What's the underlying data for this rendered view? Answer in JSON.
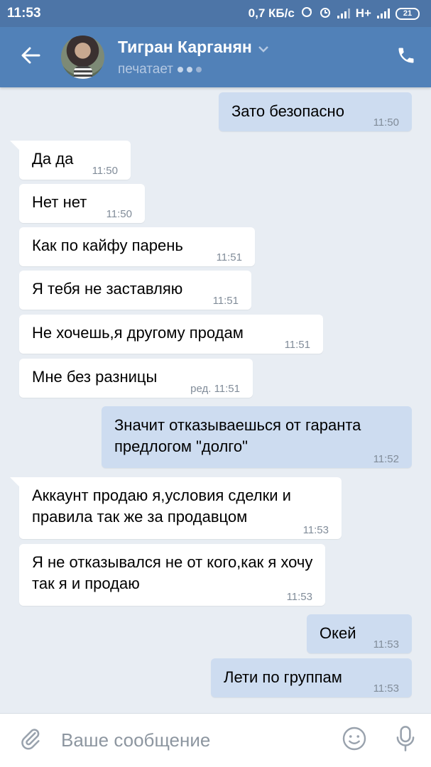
{
  "status_bar": {
    "time": "11:53",
    "net_speed": "0,7 КБ/с",
    "network_type": "H+",
    "battery": "21",
    "icons": [
      "sync-icon",
      "alarm-icon",
      "signal-icon",
      "signal-icon",
      "battery-icon"
    ]
  },
  "header": {
    "contact_name": "Тигран Карганян",
    "status": "печатает",
    "icons": [
      "back-arrow-icon",
      "chevron-down-icon",
      "phone-icon"
    ]
  },
  "messages": [
    {
      "direction": "out",
      "text": "Зато безопасно",
      "time": "11:50"
    },
    {
      "direction": "in",
      "text": "Да да",
      "time": "11:50"
    },
    {
      "direction": "in",
      "text": "Нет нет",
      "time": "11:50"
    },
    {
      "direction": "in",
      "text": "Как по кайфу парень",
      "time": "11:51"
    },
    {
      "direction": "in",
      "text": "Я тебя не заставляю",
      "time": "11:51"
    },
    {
      "direction": "in",
      "text": "Не хочешь,я другому продам",
      "time": "11:51"
    },
    {
      "direction": "in",
      "text": "Мне без разницы",
      "time": "ред. 11:51"
    },
    {
      "direction": "out",
      "text": "Значит отказываешься от гаранта предлогом \"долго\"",
      "time": "11:52"
    },
    {
      "direction": "in",
      "text": "Аккаунт продаю я,условия сделки и правила так же за продавцом",
      "time": "11:53"
    },
    {
      "direction": "in",
      "text": "Я не отказывался не от кого,как я хочу так я и продаю",
      "time": "11:53"
    },
    {
      "direction": "out",
      "text": "Окей",
      "time": "11:53"
    },
    {
      "direction": "out",
      "text": "Лети по группам",
      "time": "11:53"
    }
  ],
  "composer": {
    "placeholder": "Ваше сообщение",
    "icons": [
      "paperclip-icon",
      "emoji-icon",
      "microphone-icon"
    ]
  },
  "colors": {
    "header": "#5181b8",
    "statusbar": "#4d75a7",
    "background": "#e8edf3",
    "incoming_bubble": "#ffffff",
    "outgoing_bubble": "#cddcf0",
    "time_text": "#818c99"
  }
}
